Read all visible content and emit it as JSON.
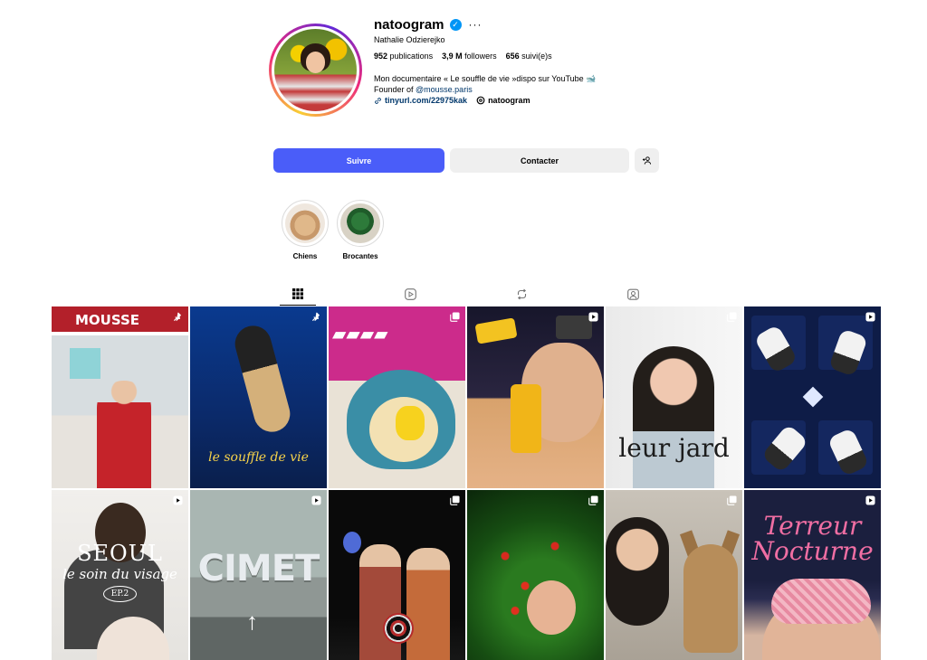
{
  "profile": {
    "username": "natoogram",
    "full_name": "Nathalie Odzierejko",
    "stats": {
      "publications_value": "952",
      "publications_label": "publications",
      "followers_value": "3,9 M",
      "followers_label": "followers",
      "following_value": "656",
      "following_label": "suivi(e)s"
    },
    "bio_line1": "Mon documentaire « Le souffle de vie »dispo sur YouTube 🐋",
    "bio_line2_prefix": "Founder of ",
    "bio_mention": "@mousse.paris",
    "link": "tinyurl.com/22975kak",
    "threads_handle": "natoogram"
  },
  "actions": {
    "follow_label": "Suivre",
    "contact_label": "Contacter"
  },
  "highlights": [
    {
      "label": "Chiens"
    },
    {
      "label": "Brocantes"
    }
  ],
  "tabs": [
    {
      "icon": "grid-icon",
      "active": true
    },
    {
      "icon": "reels-icon",
      "active": false
    },
    {
      "icon": "reposts-icon",
      "active": false
    },
    {
      "icon": "tagged-icon",
      "active": false
    }
  ],
  "posts": [
    {
      "badge": "pin-icon",
      "text": "MOUSSE"
    },
    {
      "badge": "pin-icon",
      "text": "le souffle de vie"
    },
    {
      "badge": "carousel-icon",
      "text": ""
    },
    {
      "badge": "reel-icon",
      "text": ""
    },
    {
      "badge": "carousel-icon",
      "text": "leur jard"
    },
    {
      "badge": "reel-icon",
      "text": ""
    },
    {
      "badge": "reel-icon",
      "text_line1": "SEOUL",
      "text_line2": "le soin du visage",
      "text_line3": "EP.2"
    },
    {
      "badge": "reel-icon",
      "text": "CIMET"
    },
    {
      "badge": "carousel-icon",
      "text": ""
    },
    {
      "badge": "carousel-icon",
      "text": ""
    },
    {
      "badge": "carousel-icon",
      "text": ""
    },
    {
      "badge": "reel-icon",
      "text_line1": "Terreur",
      "text_line2": "Nocturne"
    }
  ],
  "colors": {
    "follow_button": "#4a5df9",
    "secondary_button": "#efefef",
    "verified_badge": "#0095f6",
    "link": "#00376b"
  }
}
